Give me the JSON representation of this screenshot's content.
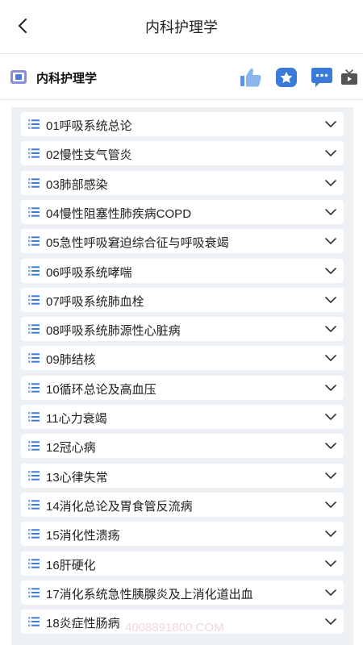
{
  "header": {
    "title": "内科护理学"
  },
  "course": {
    "name": "内科护理学"
  },
  "colors": {
    "accent": "#3a7ad9",
    "icon_light": "#7fb0ef",
    "background": "#edf1f6"
  },
  "icons": {
    "back": "chevron-left-icon",
    "like": "thumbs-up-icon",
    "favorite": "star-icon",
    "comment": "chat-bubble-icon",
    "video": "tv-icon"
  },
  "chapters": [
    "01呼吸系统总论",
    "02慢性支气管炎",
    "03肺部感染",
    "04慢性阻塞性肺疾病COPD",
    "05急性呼吸窘迫综合征与呼吸衰竭",
    "06呼吸系统哮喘",
    "07呼吸系统肺血栓",
    "08呼吸系统肺源性心脏病",
    "09肺结核",
    "10循环总论及高血压",
    "11心力衰竭",
    "12冠心病",
    "13心律失常",
    "14消化总论及胃食管反流病",
    "15消化性溃疡",
    "16肝硬化",
    "17消化系统急性胰腺炎及上消化道出血",
    "18炎症性肠病"
  ],
  "watermark": "：4008891800.COM"
}
